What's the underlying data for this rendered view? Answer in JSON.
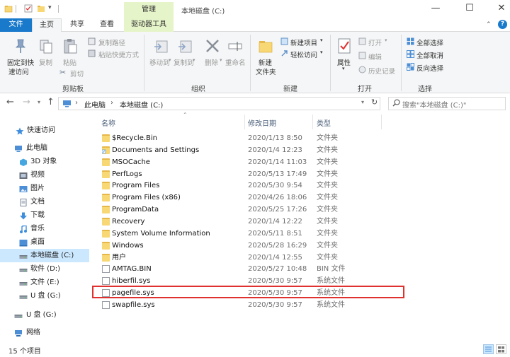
{
  "window": {
    "context_tab": "管理",
    "title": "本地磁盘 (C:)",
    "minimize": "—",
    "maximize": "☐",
    "close": "✕"
  },
  "tabs": {
    "file": "文件",
    "home": "主页",
    "share": "共享",
    "view": "查看",
    "drive_tools": "驱动器工具",
    "help": "?"
  },
  "ribbon": {
    "clipboard": {
      "pin_line1": "固定到快",
      "pin_line2": "速访问",
      "copy": "复制",
      "paste": "粘贴",
      "copy_path": "复制路径",
      "paste_shortcut": "粘贴快捷方式",
      "cut": "剪切",
      "label": "剪贴板"
    },
    "organize": {
      "move_to": "移动到",
      "copy_to": "复制到",
      "delete": "删除",
      "rename": "重命名",
      "label": "组织"
    },
    "new": {
      "new_folder_line1": "新建",
      "new_folder_line2": "文件夹",
      "new_item": "新建项目",
      "easy_access": "轻松访问",
      "label": "新建"
    },
    "open": {
      "properties": "属性",
      "open": "打开",
      "edit": "编辑",
      "history": "历史记录",
      "label": "打开"
    },
    "select": {
      "select_all": "全部选择",
      "select_none": "全部取消",
      "invert": "反向选择",
      "label": "选择"
    }
  },
  "address": {
    "crumb1": "此电脑",
    "crumb2": "本地磁盘 (C:)",
    "sep": "›",
    "search_placeholder": "搜索\"本地磁盘 (C:)\""
  },
  "nav": [
    {
      "label": "快速访问"
    },
    {
      "label": "此电脑"
    },
    {
      "label": "3D 对象"
    },
    {
      "label": "视频"
    },
    {
      "label": "图片"
    },
    {
      "label": "文档"
    },
    {
      "label": "下载"
    },
    {
      "label": "音乐"
    },
    {
      "label": "桌面"
    },
    {
      "label": "本地磁盘 (C:)"
    },
    {
      "label": "软件 (D:)"
    },
    {
      "label": "文件 (E:)"
    },
    {
      "label": "U 盘 (G:)"
    },
    {
      "label": "U 盘 (G:)"
    },
    {
      "label": "网络"
    }
  ],
  "columns": {
    "name": "名称",
    "date": "修改日期",
    "type": "类型"
  },
  "files": [
    {
      "name": "$Recycle.Bin",
      "date": "2020/1/13 8:50",
      "type": "文件夹",
      "kind": "folder"
    },
    {
      "name": "Documents and Settings",
      "date": "2020/1/4 12:23",
      "type": "文件夹",
      "kind": "link"
    },
    {
      "name": "MSOCache",
      "date": "2020/1/14 11:03",
      "type": "文件夹",
      "kind": "folder"
    },
    {
      "name": "PerfLogs",
      "date": "2020/5/13 17:49",
      "type": "文件夹",
      "kind": "folder"
    },
    {
      "name": "Program Files",
      "date": "2020/5/30 9:54",
      "type": "文件夹",
      "kind": "folder"
    },
    {
      "name": "Program Files (x86)",
      "date": "2020/4/26 18:06",
      "type": "文件夹",
      "kind": "folder"
    },
    {
      "name": "ProgramData",
      "date": "2020/5/25 17:26",
      "type": "文件夹",
      "kind": "folder"
    },
    {
      "name": "Recovery",
      "date": "2020/1/4 12:22",
      "type": "文件夹",
      "kind": "folder"
    },
    {
      "name": "System Volume Information",
      "date": "2020/5/11 8:51",
      "type": "文件夹",
      "kind": "folder"
    },
    {
      "name": "Windows",
      "date": "2020/5/28 16:29",
      "type": "文件夹",
      "kind": "folder"
    },
    {
      "name": "用户",
      "date": "2020/1/4 12:55",
      "type": "文件夹",
      "kind": "folder"
    },
    {
      "name": "AMTAG.BIN",
      "date": "2020/5/27 10:48",
      "type": "BIN 文件",
      "kind": "file"
    },
    {
      "name": "hiberfil.sys",
      "date": "2020/5/30 9:57",
      "type": "系统文件",
      "kind": "file"
    },
    {
      "name": "pagefile.sys",
      "date": "2020/5/30 9:57",
      "type": "系统文件",
      "kind": "file"
    },
    {
      "name": "swapfile.sys",
      "date": "2020/5/30 9:57",
      "type": "系统文件",
      "kind": "file"
    }
  ],
  "status": {
    "count": "15 个项目"
  },
  "colors": {
    "accent": "#1979ca",
    "context_tab": "#e6f4c9",
    "selection": "#cce8ff",
    "highlight": "#e03131",
    "folder": "#f8d775"
  }
}
